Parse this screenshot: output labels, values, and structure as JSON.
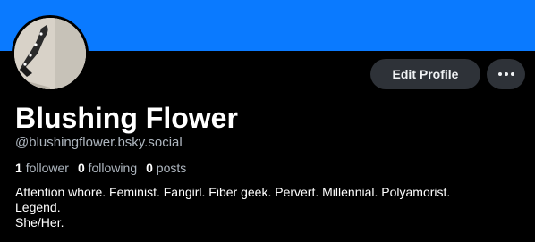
{
  "colors": {
    "banner": "#0a7aff",
    "background": "#000000",
    "button_bg": "#2e3238",
    "muted_text": "#aeb6bf"
  },
  "profile": {
    "display_name": "Blushing Flower",
    "handle": "@blushingflower.bsky.social",
    "avatar_icon": "avatar-photo"
  },
  "actions": {
    "edit_profile_label": "Edit Profile",
    "more_icon": "ellipsis-icon"
  },
  "stats": {
    "followers_count": "1",
    "followers_label": "follower",
    "following_count": "0",
    "following_label": "following",
    "posts_count": "0",
    "posts_label": "posts"
  },
  "bio": {
    "line1": "Attention whore. Feminist. Fangirl. Fiber geek. Pervert. Millennial. Polyamorist.",
    "line2": "Legend.",
    "line3": "She/Her."
  }
}
